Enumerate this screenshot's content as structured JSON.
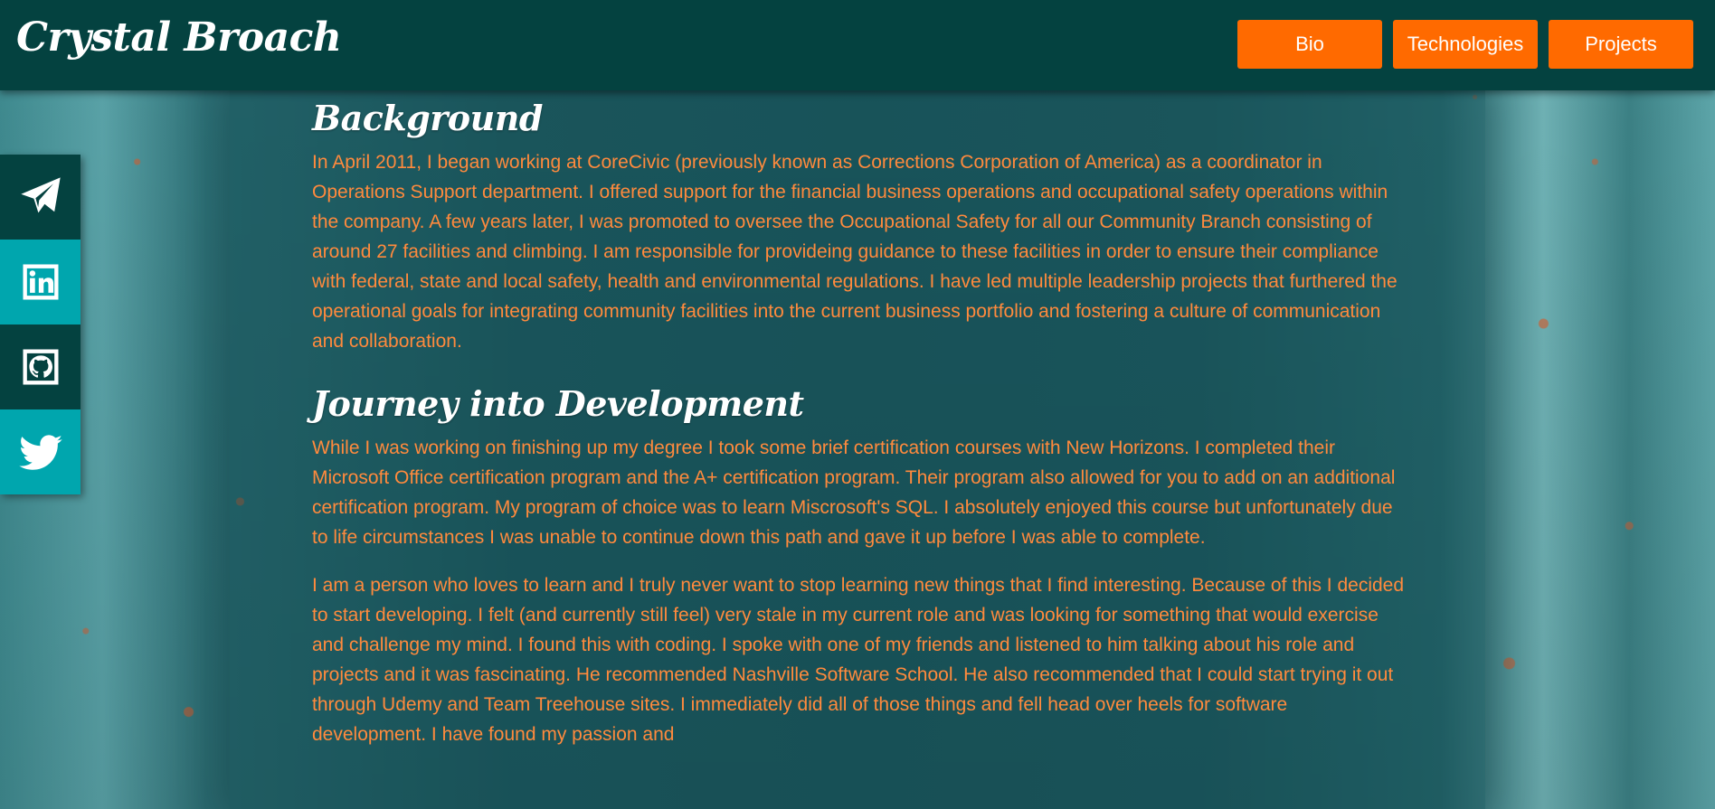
{
  "header": {
    "title": "Crystal Broach",
    "nav": [
      {
        "label": "Bio"
      },
      {
        "label": "Technologies"
      },
      {
        "label": "Projects"
      }
    ]
  },
  "social": [
    {
      "icon": "telegram-icon",
      "style": "dark"
    },
    {
      "icon": "linkedin-icon",
      "style": "teal"
    },
    {
      "icon": "github-icon",
      "style": "dark"
    },
    {
      "icon": "twitter-icon",
      "style": "teal"
    }
  ],
  "colors": {
    "header_bg": "#044240",
    "accent_orange": "#ff6a00",
    "text_orange": "#ff8a3d",
    "social_teal": "#00a6ae"
  },
  "sections": {
    "background": {
      "heading": "Background",
      "paragraph": "In April 2011, I began working at CoreCivic (previously known as Corrections Corporation of America) as a coordinator in Operations Support department. I offered support for the financial business operations and occupational safety operations within the company. A few years later, I was promoted to oversee the Occupational Safety for all our Community Branch consisting of around 27 facilities and climbing. I am responsible for provideing guidance to these facilities in order to ensure their compliance with federal, state and local safety, health and environmental regulations. I have led multiple leadership projects that furthered the operational goals for integrating community facilities into the current business portfolio and fostering a culture of communication and collaboration."
    },
    "journey": {
      "heading": "Journey into Development",
      "paragraph1": "While I was working on finishing up my degree I took some brief certification courses with New Horizons. I completed their Microsoft Office certification program and the A+ certification program. Their program also allowed for you to add on an additional certification program. My program of choice was to learn Miscrosoft's SQL. I absolutely enjoyed this course but unfortunately due to life circumstances I was unable to continue down this path and gave it up before I was able to complete.",
      "paragraph2": "I am a person who loves to learn and I truly never want to stop learning new things that I find interesting. Because of this I decided to start developing. I felt (and currently still feel) very stale in my current role and was looking for something that would exercise and challenge my mind. I found this with coding. I spoke with one of my friends and listened to him talking about his role and projects and it was fascinating. He recommended Nashville Software School. He also recommended that I could start trying it out through Udemy and Team Treehouse sites. I immediately did all of those things and fell head over heels for software development. I have found my passion and"
    }
  }
}
